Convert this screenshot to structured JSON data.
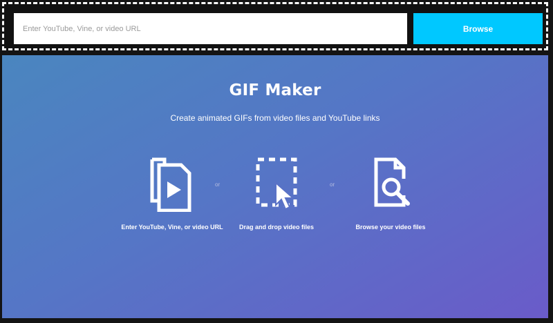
{
  "search": {
    "placeholder": "Enter YouTube, Vine, or video URL",
    "value": ""
  },
  "browse_button_label": "Browse",
  "hero": {
    "title": "GIF Maker",
    "subtitle": "Create animated GIFs from video files and YouTube links"
  },
  "options": [
    {
      "icon": "video-file-icon",
      "label": "Enter YouTube, Vine, or video URL"
    },
    {
      "icon": "drag-drop-icon",
      "label": "Drag and drop video files"
    },
    {
      "icon": "file-search-icon",
      "label": "Browse your video files"
    }
  ],
  "separator_label": "or",
  "colors": {
    "accent": "#00c8ff",
    "gradient_start": "#4a86bf",
    "gradient_end": "#6a5bc9",
    "frame": "#141414"
  }
}
